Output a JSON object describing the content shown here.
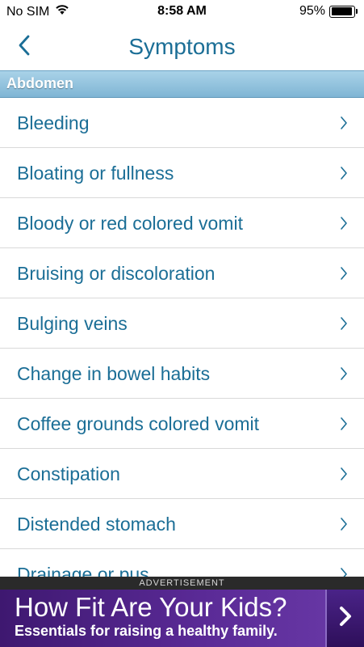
{
  "status_bar": {
    "carrier": "No SIM",
    "time": "8:58 AM",
    "battery": "95%",
    "battery_level": 0.95
  },
  "nav": {
    "title": "Symptoms",
    "back_icon": "chevron-left-icon",
    "accent_color": "#1b6e96"
  },
  "section": {
    "title": "Abdomen"
  },
  "symptoms": [
    "Bleeding",
    "Bloating or fullness",
    "Bloody or red colored vomit",
    "Bruising or discoloration",
    "Bulging veins",
    "Change in bowel habits",
    "Coffee grounds colored vomit",
    "Constipation",
    "Distended stomach",
    "Drainage or pus"
  ],
  "ad": {
    "label": "ADVERTISEMENT",
    "headline": "How Fit Are Your Kids?",
    "subline": "Essentials for raising a healthy family.",
    "arrow_icon": "chevron-right-icon"
  }
}
